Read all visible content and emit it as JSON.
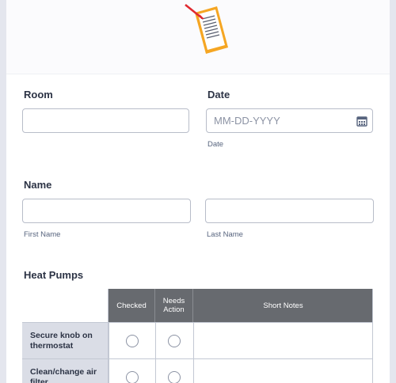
{
  "form": {
    "room": {
      "label": "Room",
      "value": ""
    },
    "date": {
      "label": "Date",
      "placeholder": "MM-DD-YYYY",
      "sublabel": "Date"
    },
    "name": {
      "label": "Name",
      "first_sublabel": "First Name",
      "last_sublabel": "Last Name",
      "first_value": "",
      "last_value": ""
    },
    "heat_pumps": {
      "label": "Heat Pumps",
      "columns": [
        "Checked",
        "Needs Action",
        "Short Notes"
      ],
      "rows": [
        {
          "label": "Secure knob on thermostat"
        },
        {
          "label": "Clean/change air filter"
        }
      ]
    }
  },
  "icons": {
    "logo": "clipboard-document-icon",
    "calendar": "calendar-icon"
  },
  "colors": {
    "header_bg": "#676a6f",
    "row_label_bg": "#dadde6",
    "logo_orange": "#f5a623",
    "logo_red": "#e0282e"
  }
}
